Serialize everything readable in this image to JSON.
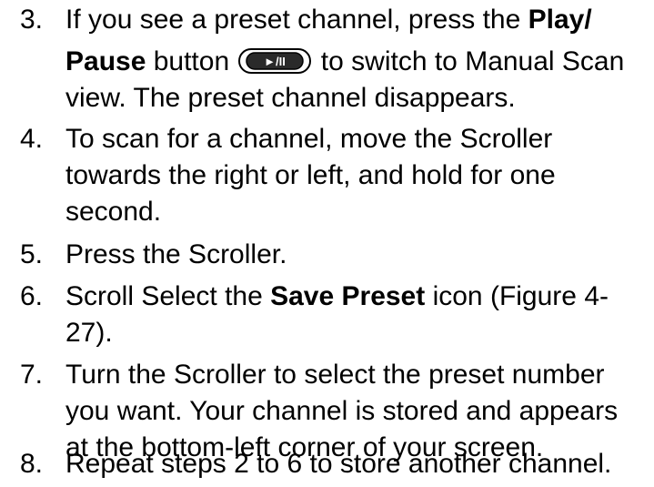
{
  "steps": [
    {
      "number": "3.",
      "l1_pre": "If you see a preset channel, press the ",
      "l1_bold": "Play/",
      "l2_bold": "Pause",
      "l2_mid": " button ",
      "l2_post": " to switch to Manual Scan",
      "l3": "view. The preset channel disappears.",
      "icon": "play-pause-button-icon",
      "icon_label": "►/II"
    },
    {
      "number": "4.",
      "lines": [
        "To scan for a channel, move the Scroller",
        "towards the right or left, and hold for one",
        "second."
      ]
    },
    {
      "number": "5.",
      "lines": [
        "Press the Scroller."
      ]
    },
    {
      "number": "6.",
      "l1_pre": "Scroll Select the ",
      "l1_bold": "Save Preset",
      "l1_post": " icon (Figure 4-",
      "l2": "27)."
    },
    {
      "number": "7.",
      "lines": [
        "Turn the Scroller to select the preset number",
        "you want. Your channel is stored and appears",
        "at the bottom-left corner of your screen."
      ]
    },
    {
      "number": "8.",
      "lines": [
        "Repeat steps 2 to 6 to store another channel."
      ]
    }
  ]
}
